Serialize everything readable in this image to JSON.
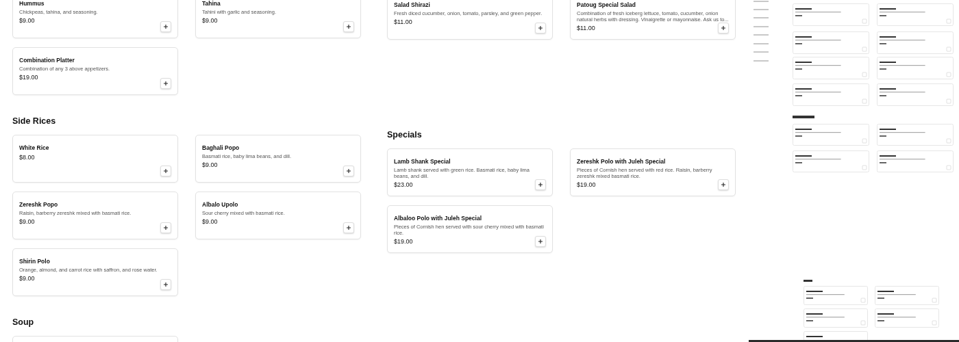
{
  "left_panel": {
    "sections": [
      {
        "items": [
          {
            "name": "Hummus",
            "description": "Chickpeas, tahina, and seasoning.",
            "price": "$9.00"
          },
          {
            "name": "Tahina",
            "description": "Tahini with garlic and seasoning.",
            "price": "$9.00"
          },
          {
            "name": "Combination Platter",
            "description": "Combination of any 3 above appetizers.",
            "price": "$19.00"
          }
        ]
      },
      {
        "heading": "Side Rices",
        "items": [
          {
            "name": "White Rice",
            "price": "$8.00"
          },
          {
            "name": "Baghali Popo",
            "description": "Basmati rice, baby lima beans, and dill.",
            "price": "$9.00"
          },
          {
            "name": "Zereshk Popo",
            "description": "Raisin, barberry zereshk mixed with basmati rice.",
            "price": "$9.00"
          },
          {
            "name": "Albalo Upolo",
            "description": "Sour cherry mixed with basmati rice.",
            "price": "$9.00"
          },
          {
            "name": "Shirin Polo",
            "description": "Orange, almond, and carrot rice with saffron, and rose water.",
            "price": "$9.00"
          }
        ]
      },
      {
        "heading": "Soup",
        "cut_off_card": true
      }
    ]
  },
  "right_panel": {
    "sections": [
      {
        "items": [
          {
            "name": "Salad Shirazi",
            "description": "Fresh diced cucumber, onion, tomato, parsley, and green pepper.",
            "price": "$11.00"
          },
          {
            "name": "Patoug Special Salad",
            "description": "Combination of fresh iceberg lettuce, tomato, cucumber, onion natural herbs with dressing. Vinaigrette or mayonnaise. Ask us to...",
            "price": "$11.00"
          }
        ]
      },
      {
        "heading": "Specials",
        "items": [
          {
            "name": "Lamb Shank Special",
            "description": "Lamb shank served with green rice. Basmati rice, baby lima beans, and dill.",
            "price": "$23.00"
          },
          {
            "name": "Zereshk Polo with Juleh Special",
            "description": "Pieces of Cornish hen served with red rice. Raisin, barberry zereshk mixed basmati rice.",
            "price": "$19.00"
          },
          {
            "name": "Albaloo Polo with Juleh Special",
            "description": "Pieces of Cornish hen served with sour cherry mixed with basmati rice.",
            "price": "$19.00"
          }
        ]
      }
    ]
  }
}
